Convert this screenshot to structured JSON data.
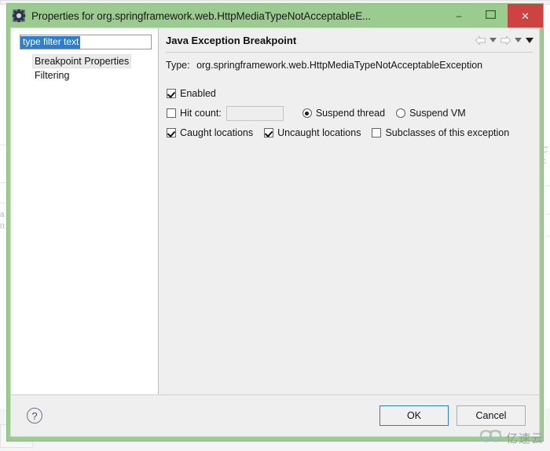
{
  "window": {
    "title": "Properties for org.springframework.web.HttpMediaTypeNotAcceptableE...",
    "icon": "gear-icon",
    "minimize_label": "–",
    "maximize_label": "❐",
    "close_label": "✕",
    "titlebar_color": "#9ccb8f",
    "close_color": "#cf4242"
  },
  "filter": {
    "value": "type filter text",
    "placeholder": "type filter text",
    "selection_color": "#2a7fd4"
  },
  "tree": {
    "items": [
      {
        "label": "Breakpoint Properties",
        "selected": true
      },
      {
        "label": "Filtering",
        "selected": false
      }
    ]
  },
  "page": {
    "title": "Java Exception Breakpoint",
    "nav": {
      "back_icon": "back-arrow-icon",
      "back_caret_icon": "chevron-down-icon",
      "forward_icon": "forward-arrow-icon",
      "forward_caret_icon": "chevron-down-icon",
      "menu_icon": "chevron-down-icon"
    },
    "type_label": "Type:",
    "type_value": "org.springframework.web.HttpMediaTypeNotAcceptableException",
    "enabled": {
      "label": "Enabled",
      "checked": true
    },
    "hit_count": {
      "label": "Hit count:",
      "checked": false,
      "value": ""
    },
    "suspend_thread": {
      "label": "Suspend thread",
      "selected": true
    },
    "suspend_vm": {
      "label": "Suspend VM",
      "selected": false
    },
    "caught_locations": {
      "label": "Caught locations",
      "checked": true
    },
    "uncaught_locations": {
      "label": "Uncaught locations",
      "checked": true
    },
    "subclasses": {
      "label": "Subclasses of this exception",
      "checked": false
    }
  },
  "footer": {
    "help_icon": "help-question-icon",
    "help_label": "?",
    "ok_label": "OK",
    "cancel_label": "Cancel"
  },
  "watermark": {
    "text": "亿速云",
    "icon": "cloud-logo-icon"
  }
}
